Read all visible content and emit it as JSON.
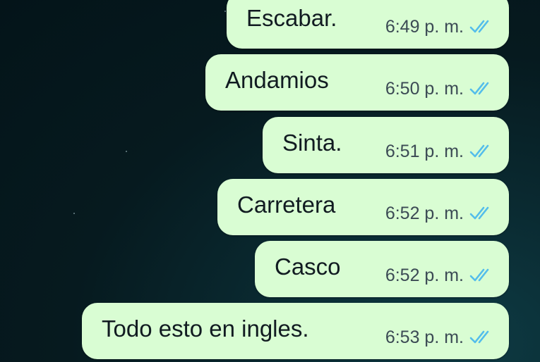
{
  "chat": {
    "messages": [
      {
        "text": "Escabar.",
        "time": "6:49 p. m.",
        "status": "read",
        "status_icon": "double-check-icon"
      },
      {
        "text": "Andamios",
        "time": "6:50 p. m.",
        "status": "read",
        "status_icon": "double-check-icon"
      },
      {
        "text": "Sinta.",
        "time": "6:51 p. m.",
        "status": "read",
        "status_icon": "double-check-icon"
      },
      {
        "text": "Carretera",
        "time": "6:52 p. m.",
        "status": "read",
        "status_icon": "double-check-icon"
      },
      {
        "text": "Casco",
        "time": "6:52 p. m.",
        "status": "read",
        "status_icon": "double-check-icon"
      },
      {
        "text": "Todo esto en ingles.",
        "time": "6:53 p. m.",
        "status": "read",
        "status_icon": "double-check-icon"
      }
    ]
  },
  "colors": {
    "bubble_background": "#d9fdd3",
    "message_text": "#111b21",
    "time_text": "#3b4a54",
    "read_ticks": "#53bdeb",
    "wallpaper": "#061a1f"
  }
}
